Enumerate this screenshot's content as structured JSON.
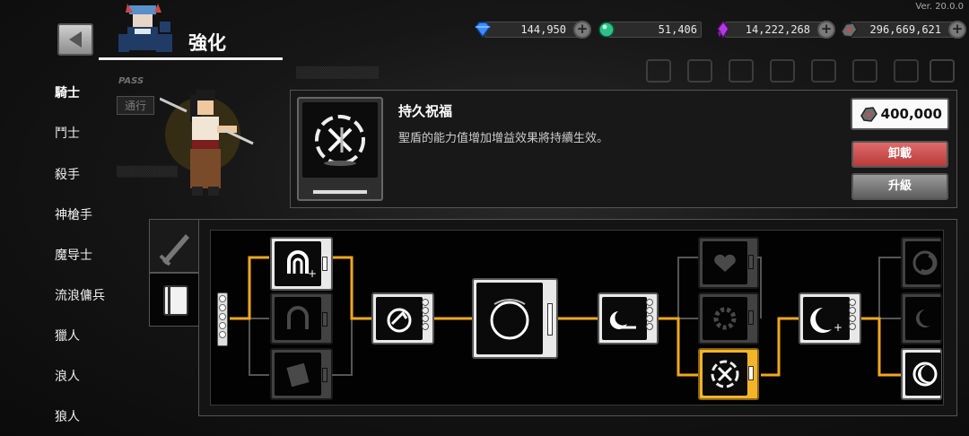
{
  "app": {
    "version": "Ver. 20.0.0",
    "title": "強化"
  },
  "currencies": [
    {
      "name": "diamond",
      "value": "144,950",
      "color": "#3a8cff"
    },
    {
      "name": "emerald",
      "value": "51,406",
      "color": "#2ec08a"
    },
    {
      "name": "purple-crystal",
      "value": "14,222,268",
      "color": "#b23be0"
    },
    {
      "name": "ore",
      "value": "296,669,621",
      "color": "#c0392b"
    }
  ],
  "sidebar": {
    "classes": [
      "騎士",
      "鬥士",
      "殺手",
      "神槍手",
      "魔导士",
      "流浪傭兵",
      "獵人",
      "浪人",
      "狼人"
    ],
    "active_index": 0
  },
  "pass_banner": {
    "pass_label": "PASS",
    "button_label": "通行"
  },
  "skill": {
    "name": "持久祝福",
    "description": "聖盾的能力值增加增益效果將持續生效。",
    "cost": "400,000",
    "unequip_label": "卸載",
    "upgrade_label": "升級"
  },
  "tabs": [
    {
      "name": "sword",
      "active": false
    },
    {
      "name": "book",
      "active": true
    }
  ],
  "tree": {
    "accent_color": "#f0a81e",
    "selected_node": "node-c3r3"
  }
}
